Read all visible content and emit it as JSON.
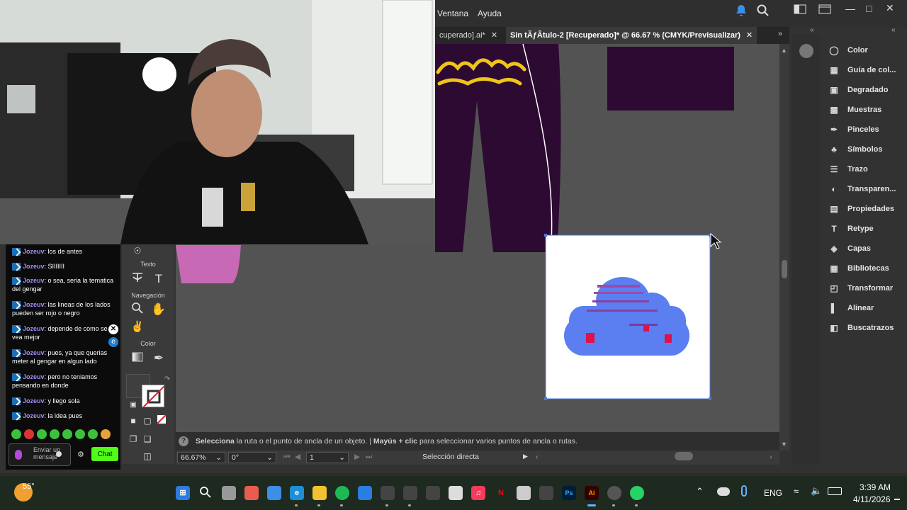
{
  "menu": {
    "items": [
      "Ventana",
      "Ayuda"
    ]
  },
  "tabs": [
    {
      "label": "cuperado].ai*",
      "active": false
    },
    {
      "label": "Sin tÃƒÂ­tulo-2 [Recuperado]* @ 66.67 % (CMYK/Previsualizar)",
      "active": true
    }
  ],
  "toolpanel": {
    "section_text": "Texto",
    "section_nav": "Navegación",
    "section_color": "Color"
  },
  "status": {
    "hint_bold_1": "Selecciona",
    "hint_1": "la ruta o el punto de ancla de un objeto.",
    "hint_sep": "|",
    "hint_bold_2": "Mayús + clic",
    "hint_2": "para seleccionar varios puntos de ancla o rutas.",
    "zoom": "66.67%",
    "rotation": "0°",
    "artboard": "1",
    "tool": "Selección directa"
  },
  "dock": {
    "items": [
      {
        "label": "Color",
        "icon": "color-palette-icon"
      },
      {
        "label": "Guía de col...",
        "icon": "color-guide-icon"
      },
      {
        "label": "Degradado",
        "icon": "gradient-icon"
      },
      {
        "label": "Muestras",
        "icon": "swatches-icon"
      },
      {
        "label": "Pinceles",
        "icon": "brush-icon"
      },
      {
        "label": "Símbolos",
        "icon": "symbols-icon"
      },
      {
        "label": "Trazo",
        "icon": "stroke-icon"
      },
      {
        "label": "Transparen...",
        "icon": "transparency-icon"
      },
      {
        "label": "Propiedades",
        "icon": "properties-icon"
      },
      {
        "label": "Retype",
        "icon": "retype-icon"
      },
      {
        "label": "Capas",
        "icon": "layers-icon"
      },
      {
        "label": "Bibliotecas",
        "icon": "libraries-icon"
      },
      {
        "label": "Transformar",
        "icon": "transform-icon"
      },
      {
        "label": "Alinear",
        "icon": "align-icon"
      },
      {
        "label": "Buscatrazos",
        "icon": "pathfinder-icon"
      }
    ]
  },
  "chat": {
    "messages": [
      {
        "user": "Jozeuv",
        "text": "los de antes"
      },
      {
        "user": "Jozeuv",
        "text": "SIIIIIII"
      },
      {
        "user": "Jozeuv",
        "text": "o sea, seria la tematica del gengar"
      },
      {
        "user": "Jozeuv",
        "text": "las lineas de los lados pueden ser rojo o negro"
      },
      {
        "user": "Jozeuv",
        "text": "depende de como se vea mejor"
      },
      {
        "user": "Jozeuv",
        "text": "pues, ya que querias meter al gengar en algun lado"
      },
      {
        "user": "Jozeuv",
        "text": "pero no teniamos pensando en donde"
      },
      {
        "user": "Jozeuv",
        "text": "y llego sola"
      },
      {
        "user": "Jozeuv",
        "text": "la idea pues"
      }
    ],
    "input_placeholder": "Enviar un mensaje",
    "send_label": "Chat"
  },
  "taskbar": {
    "weather_temp": "55°",
    "language": "ENG",
    "time": "3:39 AM",
    "date": "4/11/2026"
  },
  "colors": {
    "accent_chat": "#53fc18",
    "garment": "#2d0a32",
    "artwork_yellow": "#f0c419",
    "cloud_blue": "#5b7ff0",
    "selection": "#4a7bd8"
  }
}
